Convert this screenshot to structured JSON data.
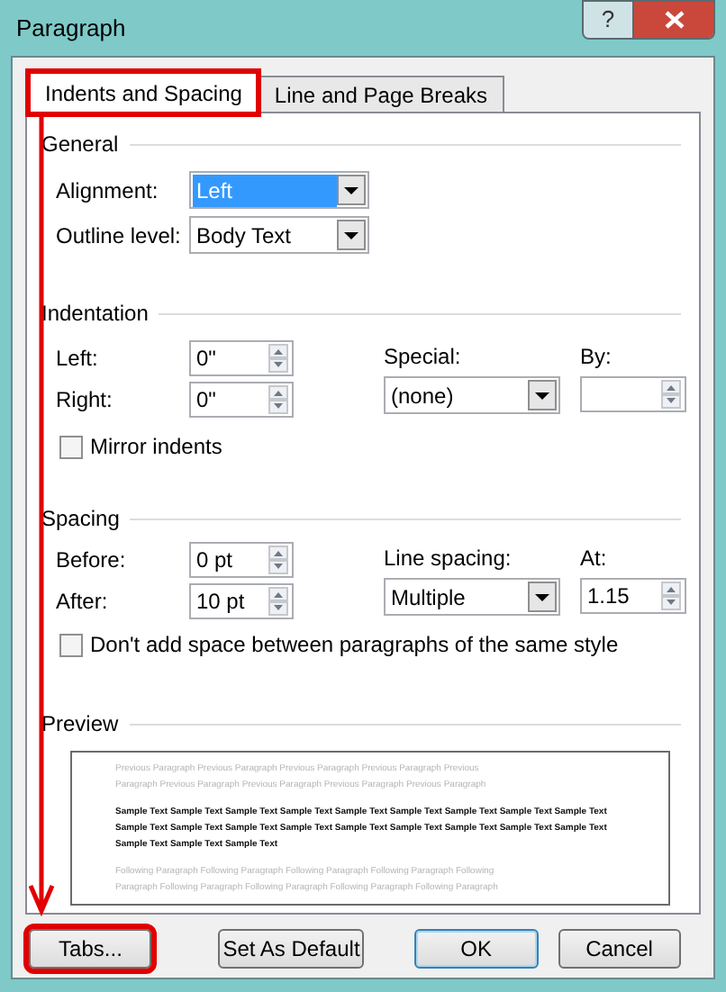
{
  "window": {
    "title": "Paragraph",
    "help_label": "?"
  },
  "tabs": [
    {
      "label": "Indents and Spacing",
      "selected": true,
      "outlined": true
    },
    {
      "label": "Line and Page Breaks",
      "selected": false,
      "outlined": false
    }
  ],
  "general": {
    "heading": "General",
    "alignment": {
      "label": "Alignment:",
      "value": "Left",
      "highlighted": true
    },
    "outline_level": {
      "label": "Outline level:",
      "value": "Body Text"
    }
  },
  "indentation": {
    "heading": "Indentation",
    "left": {
      "label": "Left:",
      "value": "0\""
    },
    "right": {
      "label": "Right:",
      "value": "0\""
    },
    "special": {
      "label": "Special:",
      "value": "(none)"
    },
    "by": {
      "label": "By:"
    },
    "mirror": {
      "label": "Mirror indents",
      "checked": false
    }
  },
  "spacing": {
    "heading": "Spacing",
    "before": {
      "label": "Before:",
      "value": "0 pt"
    },
    "after": {
      "label": "After:",
      "value": "10 pt"
    },
    "line_spacing": {
      "label": "Line spacing:",
      "value": "Multiple"
    },
    "at": {
      "label": "At:",
      "value": "1.15"
    },
    "no_space": {
      "label": "Don't add space between paragraphs of the same style",
      "checked": false
    }
  },
  "preview": {
    "heading": "Preview",
    "lines": [
      {
        "kind": "previous",
        "text": "Previous Paragraph Previous Paragraph Previous Paragraph Previous Paragraph Previous"
      },
      {
        "kind": "previous",
        "text": "Paragraph Previous Paragraph Previous Paragraph Previous Paragraph Previous Paragraph"
      },
      {
        "kind": "sample",
        "text": "Sample Text Sample Text Sample Text Sample Text Sample Text Sample Text Sample Text Sample Text Sample Text"
      },
      {
        "kind": "sample",
        "text": "Sample Text Sample Text Sample Text Sample Text Sample Text Sample Text Sample Text Sample Text Sample Text"
      },
      {
        "kind": "sample",
        "text": "Sample Text Sample Text Sample Text"
      },
      {
        "kind": "following",
        "text": "Following Paragraph Following Paragraph Following Paragraph Following Paragraph Following"
      },
      {
        "kind": "following",
        "text": "Paragraph Following Paragraph Following Paragraph Following Paragraph Following Paragraph"
      }
    ]
  },
  "buttons": [
    {
      "label": "Tabs...",
      "kind": "normal",
      "outlined": true
    },
    {
      "label": "Set As Default",
      "kind": "normal",
      "outlined": false
    },
    {
      "label": "OK",
      "kind": "default",
      "outlined": false
    },
    {
      "label": "Cancel",
      "kind": "normal",
      "outlined": false
    }
  ]
}
